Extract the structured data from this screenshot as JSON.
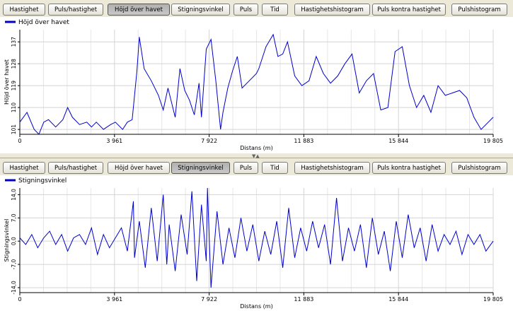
{
  "toolbar_labels": [
    "Hastighet",
    "Puls/hastighet",
    "Höjd över havet",
    "Stigningsvinkel",
    "Puls",
    "Tid",
    "Hastighetshistogram",
    "Puls kontra hastighet",
    "Pulshistogram"
  ],
  "top_panel": {
    "active_tab": "Höjd över havet",
    "chart_data": {
      "type": "line",
      "legend": "Höjd över havet",
      "xlabel": "Distans (m)",
      "ylabel": "Höjd över havet",
      "xlim": [
        0,
        19805
      ],
      "ylim": [
        99,
        142
      ],
      "x_ticks": [
        0,
        3961,
        7922,
        11883,
        15844,
        19805
      ],
      "x_tick_labels": [
        "0",
        "3 961",
        "7 922",
        "11 883",
        "15 844",
        "19 805"
      ],
      "y_ticks": [
        101,
        110,
        119,
        128,
        137
      ],
      "y_tick_labels": [
        "101",
        "110",
        "119",
        "128",
        "137"
      ],
      "color": "#0000cc",
      "series": [
        {
          "name": "Höjd över havet",
          "x": [
            0,
            300,
            600,
            800,
            1000,
            1200,
            1500,
            1800,
            2000,
            2200,
            2500,
            2800,
            3000,
            3200,
            3500,
            3800,
            4000,
            4300,
            4500,
            4700,
            4900,
            5000,
            5200,
            5500,
            5800,
            6000,
            6200,
            6500,
            6700,
            6900,
            7100,
            7300,
            7500,
            7600,
            7800,
            8000,
            8200,
            8400,
            8500,
            8700,
            8900,
            9100,
            9300,
            9500,
            9700,
            9900,
            10000,
            10300,
            10600,
            10800,
            11000,
            11200,
            11500,
            11800,
            12100,
            12400,
            12700,
            13000,
            13300,
            13600,
            13900,
            14200,
            14500,
            14800,
            15100,
            15400,
            15700,
            16000,
            16300,
            16600,
            16900,
            17200,
            17500,
            17800,
            18100,
            18400,
            18700,
            19000,
            19300,
            19600,
            19805
          ],
          "y": [
            104,
            108,
            101,
            99,
            104,
            105,
            102,
            105,
            110,
            106,
            103,
            104,
            102,
            104,
            101,
            103,
            104,
            101,
            104,
            105,
            125,
            139,
            126,
            121,
            115,
            109,
            118,
            106,
            126,
            117,
            113,
            107,
            120,
            106,
            134,
            138,
            121,
            101,
            108,
            118,
            125,
            131,
            118,
            120,
            122,
            124,
            126,
            135,
            140,
            131,
            132,
            137,
            123,
            119,
            121,
            131,
            124,
            120,
            123,
            128,
            132,
            116,
            121,
            124,
            109,
            110,
            133,
            135,
            119,
            110,
            115,
            108,
            119,
            115,
            116,
            117,
            114,
            106,
            101,
            104,
            106
          ]
        }
      ]
    }
  },
  "bottom_panel": {
    "active_tab": "Stigningsvinkel",
    "chart_data": {
      "type": "line",
      "legend": "Stigningsvinkel",
      "xlabel": "Distans (m)",
      "ylabel": "Stigningsvinkel",
      "xlim": [
        0,
        19805
      ],
      "ylim": [
        -15.5,
        16
      ],
      "x_ticks": [
        0,
        3961,
        7922,
        11883,
        15844,
        19805
      ],
      "x_tick_labels": [
        "0",
        "3 961",
        "7 922",
        "11 883",
        "15 844",
        "19 805"
      ],
      "y_ticks": [
        -14,
        -7,
        0,
        7,
        14
      ],
      "y_tick_labels": [
        "-14,0",
        "-7,0",
        "0,0",
        "7,0",
        "14,0"
      ],
      "color": "#0000cc",
      "series": [
        {
          "name": "Stigningsvinkel",
          "x": [
            0,
            250,
            500,
            750,
            1000,
            1250,
            1500,
            1750,
            2000,
            2250,
            2500,
            2750,
            3000,
            3250,
            3500,
            3750,
            4000,
            4250,
            4500,
            4750,
            4800,
            5000,
            5250,
            5500,
            5750,
            6000,
            6150,
            6250,
            6500,
            6750,
            7000,
            7200,
            7400,
            7600,
            7800,
            7850,
            8000,
            8250,
            8500,
            8750,
            9000,
            9250,
            9500,
            9750,
            10000,
            10250,
            10500,
            10750,
            11000,
            11250,
            11500,
            11750,
            12000,
            12250,
            12500,
            12750,
            13000,
            13250,
            13500,
            13750,
            14000,
            14250,
            14500,
            14750,
            15000,
            15250,
            15500,
            15750,
            16000,
            16250,
            16500,
            16750,
            17000,
            17250,
            17500,
            17750,
            18000,
            18250,
            18500,
            18750,
            19000,
            19250,
            19500,
            19805
          ],
          "y": [
            1,
            -1,
            2,
            -2,
            1,
            3,
            -1,
            2,
            -3,
            1,
            2,
            -1,
            4,
            -4,
            2,
            -2,
            1,
            4,
            -3,
            12,
            -5,
            6,
            -8,
            10,
            -6,
            14,
            -7,
            5,
            -9,
            8,
            -4,
            15,
            -12,
            11,
            -6,
            16,
            -14,
            9,
            -7,
            4,
            -5,
            7,
            -3,
            5,
            -6,
            3,
            -4,
            6,
            -8,
            10,
            -5,
            4,
            -3,
            6,
            -2,
            5,
            -7,
            13,
            -6,
            4,
            -3,
            5,
            -8,
            7,
            -4,
            3,
            -9,
            6,
            -5,
            8,
            -2,
            4,
            -6,
            5,
            -3,
            2,
            -1,
            3,
            -4,
            2,
            -1,
            2,
            -3,
            0
          ]
        }
      ]
    }
  }
}
